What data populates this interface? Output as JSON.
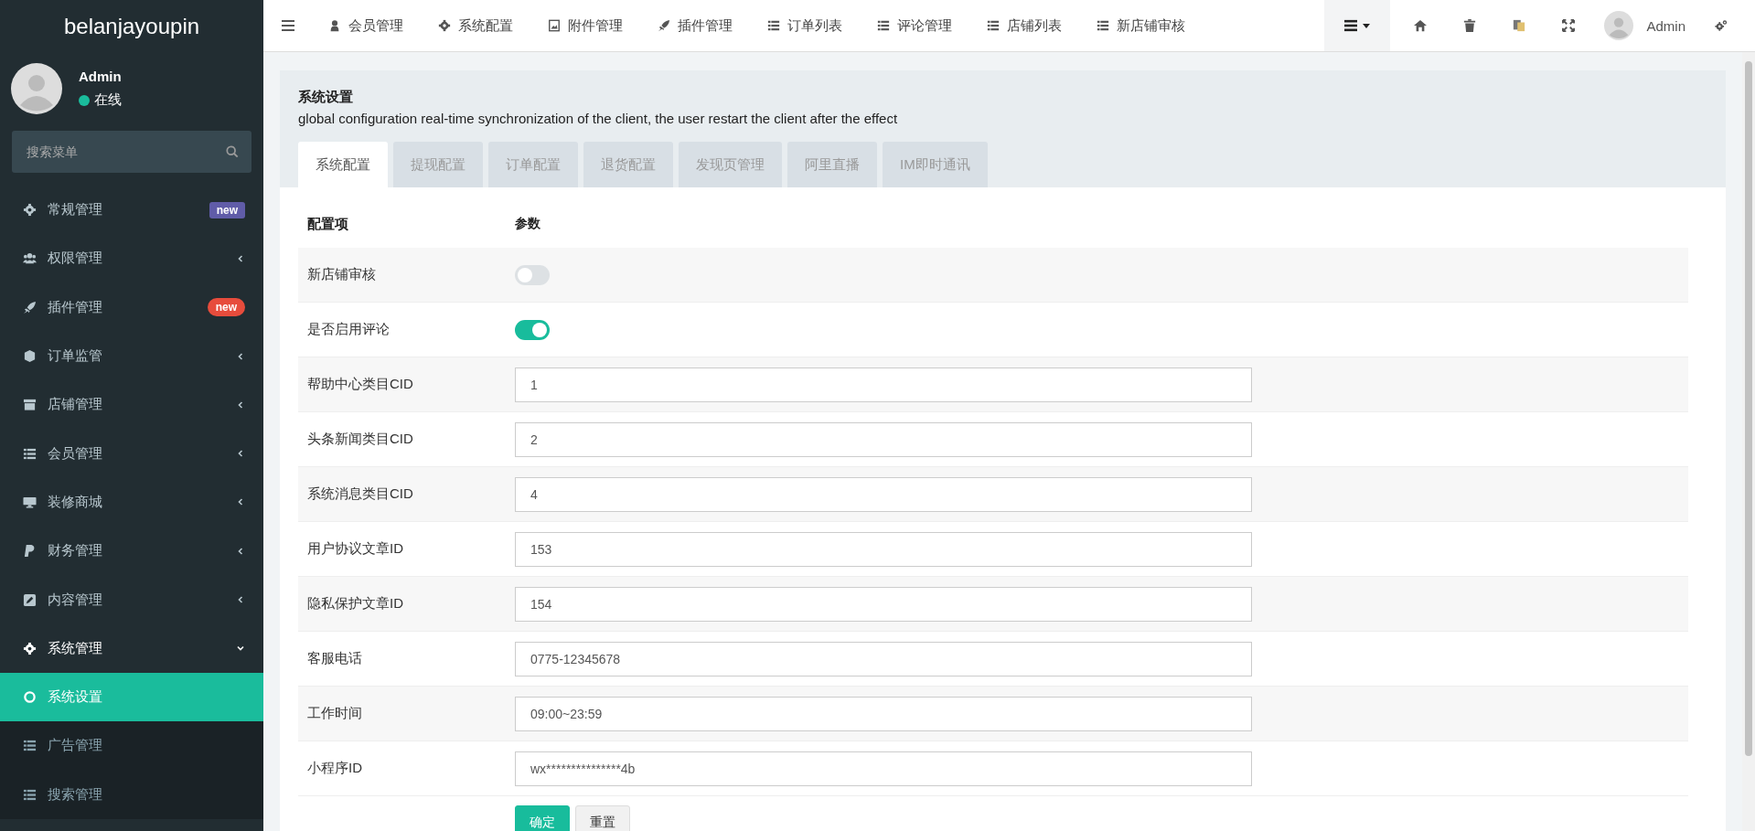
{
  "sidebar": {
    "brand": "belanjayoupin",
    "user": {
      "name": "Admin",
      "status": "在线"
    },
    "search": {
      "placeholder": "搜索菜单"
    },
    "items": [
      {
        "label": "常规管理",
        "badge": "new",
        "color": "#605ca8"
      },
      {
        "label": "权限管理",
        "expanded": false
      },
      {
        "label": "插件管理",
        "badge": "new",
        "color": "#e74c3c"
      },
      {
        "label": "订单监管",
        "expanded": false
      },
      {
        "label": "店铺管理",
        "expanded": false
      },
      {
        "label": "会员管理",
        "expanded": false
      },
      {
        "label": "装修商城",
        "expanded": false
      },
      {
        "label": "财务管理",
        "expanded": false
      },
      {
        "label": "内容管理",
        "expanded": false
      },
      {
        "label": "系统管理",
        "expanded": true,
        "children": [
          {
            "label": "系统设置",
            "selected": true
          },
          {
            "label": "广告管理",
            "selected": false
          },
          {
            "label": "搜索管理",
            "selected": false
          }
        ]
      }
    ]
  },
  "top_nav": {
    "tabs": [
      "会员管理",
      "系统配置",
      "附件管理",
      "插件管理",
      "订单列表",
      "评论管理",
      "店铺列表",
      "新店铺审核"
    ],
    "user": "Admin"
  },
  "panel": {
    "title": "系统设置",
    "description": "global configuration real-time synchronization of the client, the user restart the client after the effect",
    "tabs": [
      {
        "label": "系统配置",
        "selected": true
      },
      {
        "label": "提现配置",
        "selected": false
      },
      {
        "label": "订单配置",
        "selected": false
      },
      {
        "label": "退货配置",
        "selected": false
      },
      {
        "label": "发现页管理",
        "selected": false
      },
      {
        "label": "阿里直播",
        "selected": false
      },
      {
        "label": "IM即时通讯",
        "selected": false
      }
    ],
    "columns": [
      "配置项",
      "参数"
    ],
    "rows": [
      {
        "label": "新店铺审核",
        "kind": "toggle",
        "on": false
      },
      {
        "label": "是否启用评论",
        "kind": "toggle",
        "on": true
      },
      {
        "label": "帮助中心类目CID",
        "kind": "text",
        "value": "1"
      },
      {
        "label": "头条新闻类目CID",
        "kind": "text",
        "value": "2"
      },
      {
        "label": "系统消息类目CID",
        "kind": "text",
        "value": "4"
      },
      {
        "label": "用户协议文章ID",
        "kind": "text",
        "value": "153"
      },
      {
        "label": "隐私保护文章ID",
        "kind": "text",
        "value": "154"
      },
      {
        "label": "客服电话",
        "kind": "text",
        "value": "0775-12345678"
      },
      {
        "label": "工作时间",
        "kind": "text",
        "value": "09:00~23:59"
      },
      {
        "label": "小程序ID",
        "kind": "text",
        "value": "wx***************4b"
      }
    ],
    "buttons": [
      "确定",
      "重置"
    ]
  }
}
